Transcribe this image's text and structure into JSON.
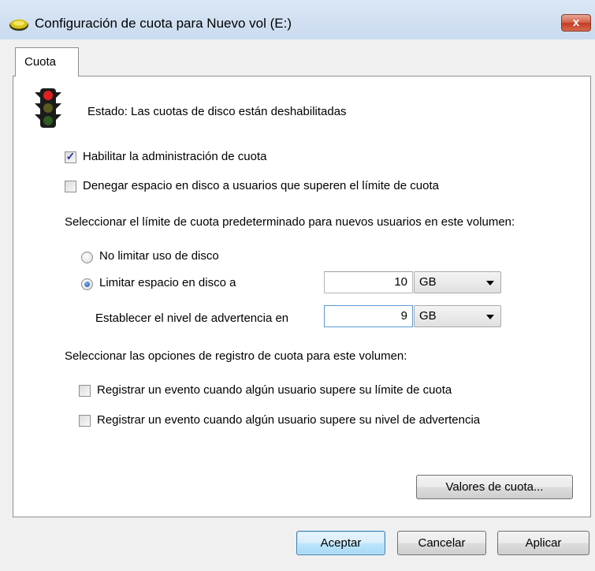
{
  "window": {
    "title": "Configuración de cuota para Nuevo vol (E:)",
    "close_label": "x"
  },
  "tab": {
    "label": "Cuota"
  },
  "status": {
    "text": "Estado:  Las cuotas de disco están deshabilitadas",
    "icon": "traffic-light-icon"
  },
  "options": {
    "enable_quota": {
      "label": "Habilitar la administración de cuota",
      "checked": true
    },
    "deny_space": {
      "label": "Denegar espacio en disco a usuarios que superen el límite de cuota",
      "checked": false
    }
  },
  "default_limit": {
    "heading": "Seleccionar el límite de cuota predeterminado para nuevos usuarios en este volumen:",
    "no_limit": {
      "label": "No limitar uso de disco",
      "selected": false
    },
    "limit": {
      "label": "Limitar espacio en disco a",
      "selected": true,
      "value": "10",
      "unit": "GB"
    },
    "warning": {
      "label": "Establecer el nivel de advertencia en",
      "value": "9",
      "unit": "GB"
    }
  },
  "logging": {
    "heading": "Seleccionar las opciones de registro de cuota para este volumen:",
    "log_limit": {
      "label": "Registrar un evento cuando algún usuario supere su límite de cuota",
      "checked": false
    },
    "log_warning": {
      "label": "Registrar un evento cuando algún usuario supere su nivel de advertencia",
      "checked": false
    }
  },
  "buttons": {
    "quota_entries": "Valores de cuota...",
    "ok": "Aceptar",
    "cancel": "Cancelar",
    "apply": "Aplicar"
  },
  "colors": {
    "title_bar": "#c9dbef",
    "close_button": "#c23a22",
    "default_button": "#3c7fb1"
  }
}
